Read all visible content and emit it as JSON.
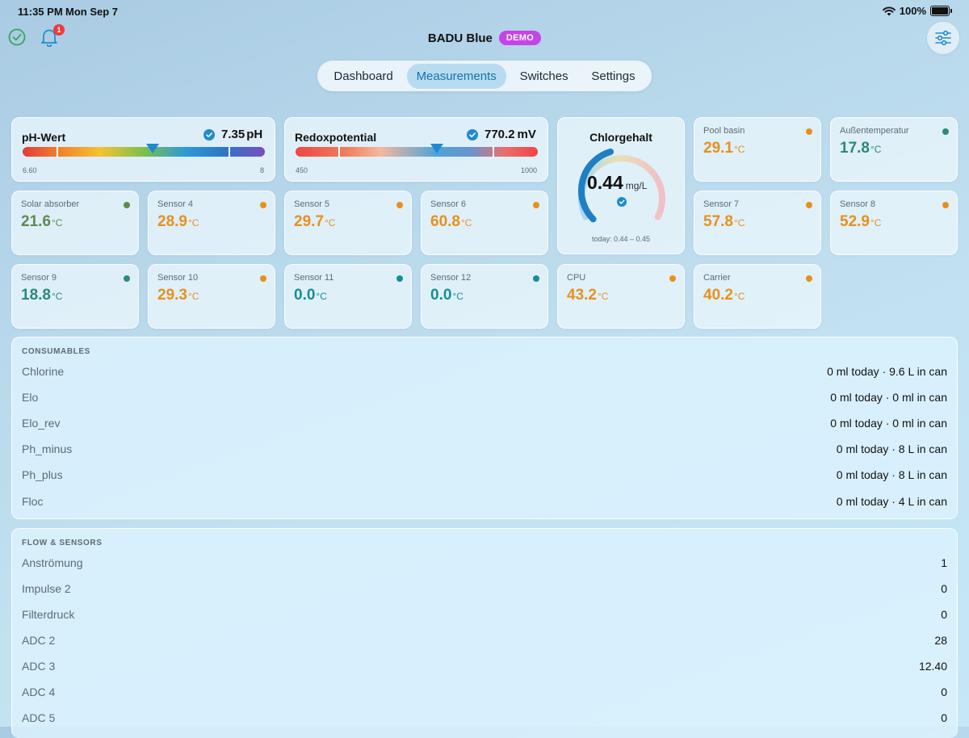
{
  "status_bar": {
    "time": "11:35 PM",
    "date": "Mon Sep 7",
    "battery": "100%"
  },
  "header": {
    "title": "BADU Blue",
    "badge": "DEMO",
    "notification_count": "1"
  },
  "tabs": [
    {
      "label": "Dashboard",
      "active": false
    },
    {
      "label": "Measurements",
      "active": true
    },
    {
      "label": "Switches",
      "active": false
    },
    {
      "label": "Settings",
      "active": false
    }
  ],
  "ph": {
    "title": "pH-Wert",
    "value": "7.35",
    "unit": "pH",
    "min": "6.60",
    "max": "8",
    "reading": 7.35,
    "range": [
      6.6,
      8.0
    ]
  },
  "redox": {
    "title": "Redoxpotential",
    "value": "770.2",
    "unit": "mV",
    "min": "450",
    "max": "1000",
    "reading": 770.2,
    "range": [
      450,
      1000
    ]
  },
  "chlorine": {
    "title": "Chlorgehalt",
    "value": "0.44",
    "unit": "mg/L",
    "range_text": "today: 0.44 – 0.45",
    "fraction": 0.44
  },
  "sensors": [
    {
      "label": "Pool basin",
      "value": "29.1",
      "unit": "°C",
      "color": "#e8901c"
    },
    {
      "label": "Außentemperatur",
      "value": "17.8",
      "unit": "°C",
      "color": "#2c8a78"
    },
    {
      "label": "Solar absorber",
      "value": "21.6",
      "unit": "°C",
      "color": "#5f8a4e"
    },
    {
      "label": "Sensor 4",
      "value": "28.9",
      "unit": "°C",
      "color": "#e8901c"
    },
    {
      "label": "Sensor 5",
      "value": "29.7",
      "unit": "°C",
      "color": "#e8901c"
    },
    {
      "label": "Sensor 6",
      "value": "60.8",
      "unit": "°C",
      "color": "#e8901c"
    },
    {
      "label": "Sensor 7",
      "value": "57.8",
      "unit": "°C",
      "color": "#e8901c"
    },
    {
      "label": "Sensor 8",
      "value": "52.9",
      "unit": "°C",
      "color": "#e8901c"
    },
    {
      "label": "Sensor 9",
      "value": "18.8",
      "unit": "°C",
      "color": "#2c8a78"
    },
    {
      "label": "Sensor 10",
      "value": "29.3",
      "unit": "°C",
      "color": "#e8901c"
    },
    {
      "label": "Sensor 11",
      "value": "0.0",
      "unit": "°C",
      "color": "#158f96"
    },
    {
      "label": "Sensor 12",
      "value": "0.0",
      "unit": "°C",
      "color": "#158f96"
    },
    {
      "label": "CPU",
      "value": "43.2",
      "unit": "°C",
      "color": "#e8901c"
    },
    {
      "label": "Carrier",
      "value": "40.2",
      "unit": "°C",
      "color": "#e8901c"
    }
  ],
  "consumables": {
    "title": "CONSUMABLES",
    "rows": [
      {
        "label": "Chlorine",
        "value": "0 ml today · 9.6 L in can"
      },
      {
        "label": "Elo",
        "value": "0 ml today · 0 ml in can"
      },
      {
        "label": "Elo_rev",
        "value": "0 ml today · 0 ml in can"
      },
      {
        "label": "Ph_minus",
        "value": "0 ml today · 8 L in can"
      },
      {
        "label": "Ph_plus",
        "value": "0 ml today · 8 L in can"
      },
      {
        "label": "Floc",
        "value": "0 ml today · 4 L in can"
      }
    ]
  },
  "flow": {
    "title": "FLOW & SENSORS",
    "rows": [
      {
        "label": "Anströmung",
        "value": "1"
      },
      {
        "label": "Impulse 2",
        "value": "0"
      },
      {
        "label": "Filterdruck",
        "value": "0"
      },
      {
        "label": "ADC 2",
        "value": "28"
      },
      {
        "label": "ADC 3",
        "value": "12.40"
      },
      {
        "label": "ADC 4",
        "value": "0"
      },
      {
        "label": "ADC 5",
        "value": "0"
      }
    ]
  }
}
